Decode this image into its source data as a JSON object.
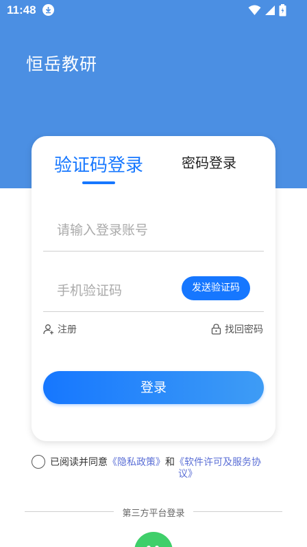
{
  "status_bar": {
    "time": "11:48"
  },
  "header": {
    "app_title": "恒岳教研"
  },
  "tabs": [
    {
      "label": "验证码登录",
      "active": true
    },
    {
      "label": "密码登录",
      "active": false
    }
  ],
  "form": {
    "account_placeholder": "请输入登录账号",
    "code_placeholder": "手机验证码",
    "send_code_label": "发送验证码",
    "register_label": "注册",
    "forgot_label": "找回密码",
    "login_label": "登录"
  },
  "agreement": {
    "prefix": "已阅读并同意",
    "privacy_link": "《隐私政策》",
    "connector": "和",
    "license_link_part1": "《软件许可及服务协",
    "license_link_part2": "议》"
  },
  "third_party": {
    "label": "第三方平台登录"
  },
  "colors": {
    "header_bg": "#4b8fe3",
    "accent": "#1677ff",
    "wechat": "#3fcf6a",
    "link": "#5b6fd6"
  },
  "icons": [
    "download-icon",
    "wifi-icon",
    "signal-icon",
    "battery-icon",
    "user-add-icon",
    "lock-icon",
    "wechat-icon"
  ]
}
